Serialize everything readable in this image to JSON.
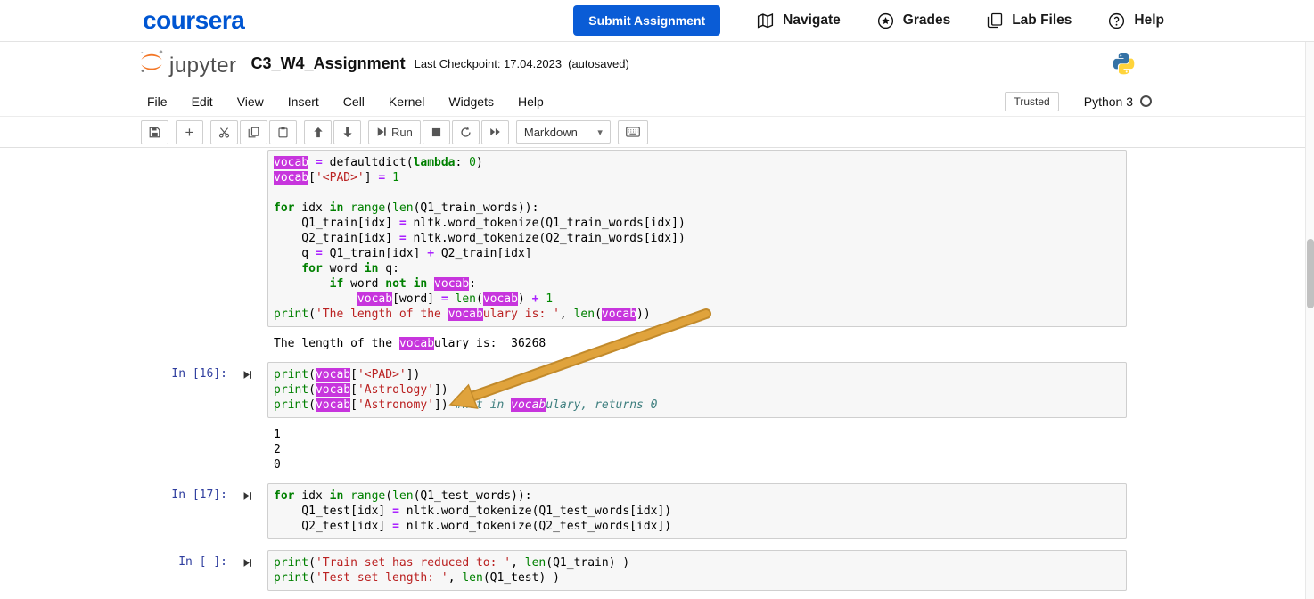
{
  "colors": {
    "coursera_blue": "#0056D2",
    "submit_bg": "#0a5cd6",
    "jupyter_orange": "#F37626",
    "highlight": "#C735DD",
    "kw": "#008000",
    "builtin": "#008000",
    "str": "#BA2121",
    "num": "#008800",
    "op": "#AA22FF",
    "comment": "#408080",
    "prompt": "#303F9F",
    "arrow": "#E0A33C"
  },
  "coursera": {
    "logo": "coursera",
    "submit_label": "Submit Assignment",
    "nav_items": [
      {
        "label": "Navigate",
        "icon": "navigate-icon"
      },
      {
        "label": "Grades",
        "icon": "grades-icon"
      },
      {
        "label": "Lab Files",
        "icon": "lab-files-icon"
      },
      {
        "label": "Help",
        "icon": "help-icon"
      }
    ]
  },
  "jupyter": {
    "logo_text": "jupyter",
    "title": "C3_W4_Assignment",
    "checkpoint": "Last Checkpoint: 17.04.2023",
    "autosaved": "(autosaved)"
  },
  "menu_items": [
    "File",
    "Edit",
    "View",
    "Insert",
    "Cell",
    "Kernel",
    "Widgets",
    "Help"
  ],
  "kernel": {
    "trusted_label": "Trusted",
    "name": "Python 3"
  },
  "toolbar": {
    "buttons": [
      {
        "name": "save",
        "icon": "save-icon",
        "group": 1
      },
      {
        "name": "insert-cell-below",
        "icon": "plus-icon",
        "group": 2
      },
      {
        "name": "cut-cells",
        "icon": "cut-icon",
        "group": 3
      },
      {
        "name": "copy-cells",
        "icon": "copy-icon",
        "group": 3
      },
      {
        "name": "paste-cells",
        "icon": "paste-icon",
        "group": 3
      },
      {
        "name": "move-cell-up",
        "icon": "arrow-up-icon",
        "group": 4
      },
      {
        "name": "move-cell-down",
        "icon": "arrow-down-icon",
        "group": 4
      },
      {
        "name": "run",
        "icon": "step-forward-icon",
        "label": "Run",
        "group": 5
      },
      {
        "name": "interrupt-kernel",
        "icon": "stop-icon",
        "group": 5
      },
      {
        "name": "restart-kernel",
        "icon": "restart-icon",
        "group": 5
      },
      {
        "name": "restart-run-all",
        "icon": "fast-forward-icon",
        "group": 5
      }
    ],
    "celltype_value": "Markdown",
    "keyboard_button_name": "command-palette"
  },
  "cells": [
    {
      "prompt": "",
      "input": [
        [
          [
            "h",
            "vocab"
          ],
          [
            "t",
            " "
          ],
          [
            "o",
            "="
          ],
          [
            "t",
            " defaultdict("
          ],
          [
            "k",
            "lambda"
          ],
          [
            "t",
            ": "
          ],
          [
            "n",
            "0"
          ],
          [
            "t",
            ")"
          ]
        ],
        [
          [
            "h",
            "vocab"
          ],
          [
            "t",
            "["
          ],
          [
            "s",
            "'<PAD>'"
          ],
          [
            "t",
            "] "
          ],
          [
            "o",
            "="
          ],
          [
            "t",
            " "
          ],
          [
            "n",
            "1"
          ]
        ],
        [],
        [
          [
            "k",
            "for"
          ],
          [
            "t",
            " idx "
          ],
          [
            "k",
            "in"
          ],
          [
            "t",
            " "
          ],
          [
            "b",
            "range"
          ],
          [
            "t",
            "("
          ],
          [
            "b",
            "len"
          ],
          [
            "t",
            "(Q1_train_words)):"
          ]
        ],
        [
          [
            "t",
            "    Q1_train[idx] "
          ],
          [
            "o",
            "="
          ],
          [
            "t",
            " nltk.word_tokenize(Q1_train_words[idx])"
          ]
        ],
        [
          [
            "t",
            "    Q2_train[idx] "
          ],
          [
            "o",
            "="
          ],
          [
            "t",
            " nltk.word_tokenize(Q2_train_words[idx])"
          ]
        ],
        [
          [
            "t",
            "    q "
          ],
          [
            "o",
            "="
          ],
          [
            "t",
            " Q1_train[idx] "
          ],
          [
            "o",
            "+"
          ],
          [
            "t",
            " Q2_train[idx]"
          ]
        ],
        [
          [
            "t",
            "    "
          ],
          [
            "k",
            "for"
          ],
          [
            "t",
            " word "
          ],
          [
            "k",
            "in"
          ],
          [
            "t",
            " q:"
          ]
        ],
        [
          [
            "t",
            "        "
          ],
          [
            "k",
            "if"
          ],
          [
            "t",
            " word "
          ],
          [
            "k",
            "not"
          ],
          [
            "t",
            " "
          ],
          [
            "k",
            "in"
          ],
          [
            "t",
            " "
          ],
          [
            "h",
            "vocab"
          ],
          [
            "t",
            ":"
          ]
        ],
        [
          [
            "t",
            "            "
          ],
          [
            "h",
            "vocab"
          ],
          [
            "t",
            "[word] "
          ],
          [
            "o",
            "="
          ],
          [
            "t",
            " "
          ],
          [
            "b",
            "len"
          ],
          [
            "t",
            "("
          ],
          [
            "h",
            "vocab"
          ],
          [
            "t",
            ") "
          ],
          [
            "o",
            "+"
          ],
          [
            "t",
            " "
          ],
          [
            "n",
            "1"
          ]
        ],
        [
          [
            "b",
            "print"
          ],
          [
            "t",
            "("
          ],
          [
            "s",
            "'The length of the "
          ],
          [
            "h",
            "vocab"
          ],
          [
            "s",
            "ulary is: '"
          ],
          [
            "t",
            ", "
          ],
          [
            "b",
            "len"
          ],
          [
            "t",
            "("
          ],
          [
            "h",
            "vocab"
          ],
          [
            "t",
            "))"
          ]
        ]
      ],
      "outputs": [
        [
          [
            "t",
            "The length of the "
          ],
          [
            "h",
            "vocab"
          ],
          [
            "t",
            "ulary is:  36268"
          ]
        ]
      ]
    },
    {
      "prompt": "In [16]:",
      "input": [
        [
          [
            "b",
            "print"
          ],
          [
            "t",
            "("
          ],
          [
            "h",
            "vocab"
          ],
          [
            "t",
            "["
          ],
          [
            "s",
            "'<PAD>'"
          ],
          [
            "t",
            "])"
          ]
        ],
        [
          [
            "b",
            "print"
          ],
          [
            "t",
            "("
          ],
          [
            "h",
            "vocab"
          ],
          [
            "t",
            "["
          ],
          [
            "s",
            "'Astrology'"
          ],
          [
            "t",
            "])"
          ]
        ],
        [
          [
            "b",
            "print"
          ],
          [
            "t",
            "("
          ],
          [
            "h",
            "vocab"
          ],
          [
            "t",
            "["
          ],
          [
            "s",
            "'Astronomy'"
          ],
          [
            "t",
            "]) "
          ],
          [
            "c",
            "#not in "
          ],
          [
            "hc",
            "vocab"
          ],
          [
            "c",
            "ulary, returns 0"
          ]
        ]
      ],
      "outputs": [
        [
          [
            "t",
            "1"
          ]
        ],
        [
          [
            "t",
            "2"
          ]
        ],
        [
          [
            "t",
            "0"
          ]
        ]
      ]
    },
    {
      "prompt": "In [17]:",
      "input": [
        [
          [
            "k",
            "for"
          ],
          [
            "t",
            " idx "
          ],
          [
            "k",
            "in"
          ],
          [
            "t",
            " "
          ],
          [
            "b",
            "range"
          ],
          [
            "t",
            "("
          ],
          [
            "b",
            "len"
          ],
          [
            "t",
            "(Q1_test_words)):"
          ]
        ],
        [
          [
            "t",
            "    Q1_test[idx] "
          ],
          [
            "o",
            "="
          ],
          [
            "t",
            " nltk.word_tokenize(Q1_test_words[idx])"
          ]
        ],
        [
          [
            "t",
            "    Q2_test[idx] "
          ],
          [
            "o",
            "="
          ],
          [
            "t",
            " nltk.word_tokenize(Q2_test_words[idx])"
          ]
        ]
      ],
      "outputs": []
    },
    {
      "prompt": "In [ ]:",
      "input": [
        [
          [
            "b",
            "print"
          ],
          [
            "t",
            "("
          ],
          [
            "s",
            "'Train set has reduced to: '"
          ],
          [
            "t",
            ", "
          ],
          [
            "b",
            "len"
          ],
          [
            "t",
            "(Q1_train) )"
          ]
        ],
        [
          [
            "b",
            "print"
          ],
          [
            "t",
            "("
          ],
          [
            "s",
            "'Test set length: '"
          ],
          [
            "t",
            ", "
          ],
          [
            "b",
            "len"
          ],
          [
            "t",
            "(Q1_test) )"
          ]
        ]
      ],
      "outputs": []
    }
  ]
}
